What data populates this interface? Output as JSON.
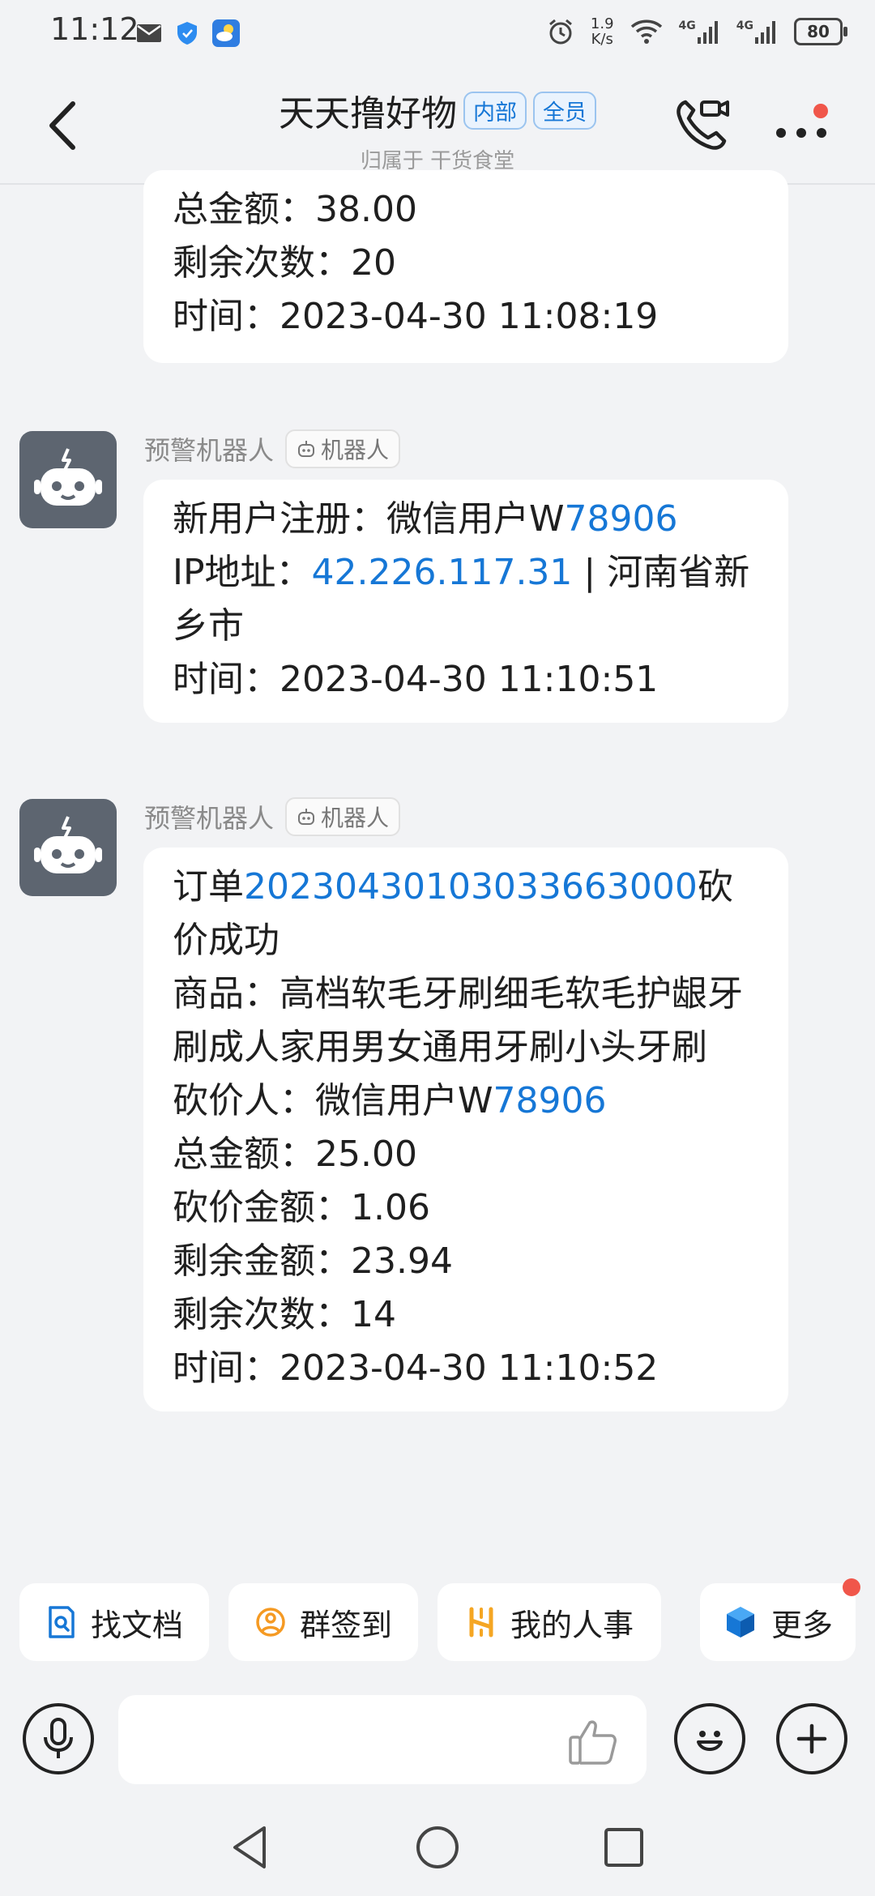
{
  "status": {
    "time": "11:12",
    "net_speed_value": "1.9",
    "net_speed_unit": "K/s",
    "signal1": "4G",
    "signal2": "4G",
    "battery": "80"
  },
  "header": {
    "title": "天天撸好物",
    "tag_internal": "内部",
    "tag_all": "全员",
    "subtitle": "归属于 干货食堂"
  },
  "messages": {
    "m0": {
      "lines": [
        "总金额：38.00",
        "剩余次数：20",
        "时间：2023-04-30 11:08:19"
      ]
    },
    "m1": {
      "sender": "预警机器人",
      "sender_tag": "机器人",
      "reg_prefix": "新用户注册：微信用户W",
      "reg_id": "78906",
      "ip_prefix": "IP地址：",
      "ip": "42.226.117.31",
      "ip_suffix": " | 河南省新乡市",
      "time": "时间：2023-04-30 11:10:51"
    },
    "m2": {
      "sender": "预警机器人",
      "sender_tag": "机器人",
      "order_prefix": "订单",
      "order_id": "20230430103033663000",
      "order_suffix": "砍价成功",
      "product": "商品：高档软毛牙刷细毛软毛护龈牙刷成人家用男女通用牙刷小头牙刷",
      "cutter_prefix": "砍价人：微信用户W",
      "cutter_id": "78906",
      "total": "总金额：25.00",
      "cut_amount": "砍价金额：1.06",
      "remaining_amount": "剩余金额：23.94",
      "remaining_times": "剩余次数：14",
      "time": "时间：2023-04-30 11:10:52"
    }
  },
  "shortcuts": [
    {
      "label": "找文档",
      "icon": "doc-search-icon",
      "color": "#1677d6"
    },
    {
      "label": "群签到",
      "icon": "location-checkin-icon",
      "color": "#f59a23"
    },
    {
      "label": "我的人事",
      "icon": "hr-icon",
      "color": "#f5a623"
    },
    {
      "label": "更多",
      "icon": "cube-more-icon",
      "color": "#1677d6"
    }
  ],
  "input": {
    "placeholder": ""
  },
  "colors": {
    "link": "#1677d6",
    "badge_red": "#f0564a",
    "avatar_bg": "#5d6570"
  }
}
